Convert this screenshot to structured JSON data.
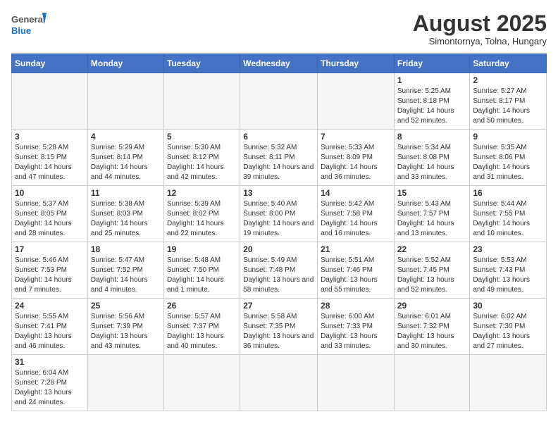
{
  "header": {
    "logo_general": "General",
    "logo_blue": "Blue",
    "month_title": "August 2025",
    "subtitle": "Simontornya, Tolna, Hungary"
  },
  "days_of_week": [
    "Sunday",
    "Monday",
    "Tuesday",
    "Wednesday",
    "Thursday",
    "Friday",
    "Saturday"
  ],
  "weeks": [
    [
      {
        "num": "",
        "info": ""
      },
      {
        "num": "",
        "info": ""
      },
      {
        "num": "",
        "info": ""
      },
      {
        "num": "",
        "info": ""
      },
      {
        "num": "",
        "info": ""
      },
      {
        "num": "1",
        "info": "Sunrise: 5:25 AM\nSunset: 8:18 PM\nDaylight: 14 hours and 52 minutes."
      },
      {
        "num": "2",
        "info": "Sunrise: 5:27 AM\nSunset: 8:17 PM\nDaylight: 14 hours and 50 minutes."
      }
    ],
    [
      {
        "num": "3",
        "info": "Sunrise: 5:28 AM\nSunset: 8:15 PM\nDaylight: 14 hours and 47 minutes."
      },
      {
        "num": "4",
        "info": "Sunrise: 5:29 AM\nSunset: 8:14 PM\nDaylight: 14 hours and 44 minutes."
      },
      {
        "num": "5",
        "info": "Sunrise: 5:30 AM\nSunset: 8:12 PM\nDaylight: 14 hours and 42 minutes."
      },
      {
        "num": "6",
        "info": "Sunrise: 5:32 AM\nSunset: 8:11 PM\nDaylight: 14 hours and 39 minutes."
      },
      {
        "num": "7",
        "info": "Sunrise: 5:33 AM\nSunset: 8:09 PM\nDaylight: 14 hours and 36 minutes."
      },
      {
        "num": "8",
        "info": "Sunrise: 5:34 AM\nSunset: 8:08 PM\nDaylight: 14 hours and 33 minutes."
      },
      {
        "num": "9",
        "info": "Sunrise: 5:35 AM\nSunset: 8:06 PM\nDaylight: 14 hours and 31 minutes."
      }
    ],
    [
      {
        "num": "10",
        "info": "Sunrise: 5:37 AM\nSunset: 8:05 PM\nDaylight: 14 hours and 28 minutes."
      },
      {
        "num": "11",
        "info": "Sunrise: 5:38 AM\nSunset: 8:03 PM\nDaylight: 14 hours and 25 minutes."
      },
      {
        "num": "12",
        "info": "Sunrise: 5:39 AM\nSunset: 8:02 PM\nDaylight: 14 hours and 22 minutes."
      },
      {
        "num": "13",
        "info": "Sunrise: 5:40 AM\nSunset: 8:00 PM\nDaylight: 14 hours and 19 minutes."
      },
      {
        "num": "14",
        "info": "Sunrise: 5:42 AM\nSunset: 7:58 PM\nDaylight: 14 hours and 16 minutes."
      },
      {
        "num": "15",
        "info": "Sunrise: 5:43 AM\nSunset: 7:57 PM\nDaylight: 14 hours and 13 minutes."
      },
      {
        "num": "16",
        "info": "Sunrise: 5:44 AM\nSunset: 7:55 PM\nDaylight: 14 hours and 10 minutes."
      }
    ],
    [
      {
        "num": "17",
        "info": "Sunrise: 5:46 AM\nSunset: 7:53 PM\nDaylight: 14 hours and 7 minutes."
      },
      {
        "num": "18",
        "info": "Sunrise: 5:47 AM\nSunset: 7:52 PM\nDaylight: 14 hours and 4 minutes."
      },
      {
        "num": "19",
        "info": "Sunrise: 5:48 AM\nSunset: 7:50 PM\nDaylight: 14 hours and 1 minute."
      },
      {
        "num": "20",
        "info": "Sunrise: 5:49 AM\nSunset: 7:48 PM\nDaylight: 13 hours and 58 minutes."
      },
      {
        "num": "21",
        "info": "Sunrise: 5:51 AM\nSunset: 7:46 PM\nDaylight: 13 hours and 55 minutes."
      },
      {
        "num": "22",
        "info": "Sunrise: 5:52 AM\nSunset: 7:45 PM\nDaylight: 13 hours and 52 minutes."
      },
      {
        "num": "23",
        "info": "Sunrise: 5:53 AM\nSunset: 7:43 PM\nDaylight: 13 hours and 49 minutes."
      }
    ],
    [
      {
        "num": "24",
        "info": "Sunrise: 5:55 AM\nSunset: 7:41 PM\nDaylight: 13 hours and 46 minutes."
      },
      {
        "num": "25",
        "info": "Sunrise: 5:56 AM\nSunset: 7:39 PM\nDaylight: 13 hours and 43 minutes."
      },
      {
        "num": "26",
        "info": "Sunrise: 5:57 AM\nSunset: 7:37 PM\nDaylight: 13 hours and 40 minutes."
      },
      {
        "num": "27",
        "info": "Sunrise: 5:58 AM\nSunset: 7:35 PM\nDaylight: 13 hours and 36 minutes."
      },
      {
        "num": "28",
        "info": "Sunrise: 6:00 AM\nSunset: 7:33 PM\nDaylight: 13 hours and 33 minutes."
      },
      {
        "num": "29",
        "info": "Sunrise: 6:01 AM\nSunset: 7:32 PM\nDaylight: 13 hours and 30 minutes."
      },
      {
        "num": "30",
        "info": "Sunrise: 6:02 AM\nSunset: 7:30 PM\nDaylight: 13 hours and 27 minutes."
      }
    ],
    [
      {
        "num": "31",
        "info": "Sunrise: 6:04 AM\nSunset: 7:28 PM\nDaylight: 13 hours and 24 minutes."
      },
      {
        "num": "",
        "info": ""
      },
      {
        "num": "",
        "info": ""
      },
      {
        "num": "",
        "info": ""
      },
      {
        "num": "",
        "info": ""
      },
      {
        "num": "",
        "info": ""
      },
      {
        "num": "",
        "info": ""
      }
    ]
  ]
}
